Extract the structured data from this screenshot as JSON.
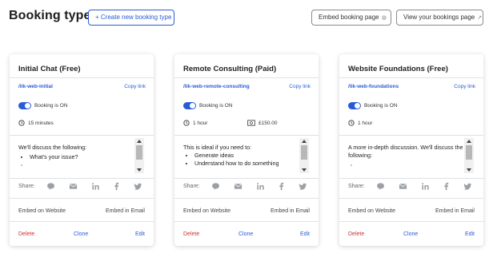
{
  "header": {
    "title": "Booking types",
    "create_button": "+ Create new booking type",
    "embed_button": "Embed booking page",
    "view_button": "View your bookings page"
  },
  "common": {
    "copy_link": "Copy link",
    "booking_status": "Booking is ON",
    "share_label": "Share:",
    "embed_website": "Embed on Website",
    "embed_email": "Embed in Email",
    "delete": "Delete",
    "clone": "Clone",
    "edit": "Edit"
  },
  "cards": [
    {
      "title": "Initial Chat (Free)",
      "slug": "/lik-web-initial",
      "duration": "15 minutes",
      "price": "",
      "desc_intro": "We'll discuss the following:",
      "desc_items": [
        "What's your issue?"
      ]
    },
    {
      "title": "Remote Consulting (Paid)",
      "slug": "/lik-web-remote-consulting",
      "duration": "1 hour",
      "price": "£150.00",
      "desc_intro": "This is ideal if you need to:",
      "desc_items": [
        "Generate ideas",
        "Understand how to do something"
      ]
    },
    {
      "title": "Website Foundations (Free)",
      "slug": "/lik-web-foundations",
      "duration": "1 hour",
      "price": "",
      "desc_intro": "A more in-depth discussion. We'll discuss the following:",
      "desc_items": []
    }
  ],
  "share_icons": [
    "chat-icon",
    "email-icon",
    "linkedin-icon",
    "facebook-icon",
    "twitter-icon"
  ],
  "colors": {
    "accent": "#2a5bd7",
    "danger": "#d32f2f",
    "icon_gray": "#9aa0a6"
  }
}
